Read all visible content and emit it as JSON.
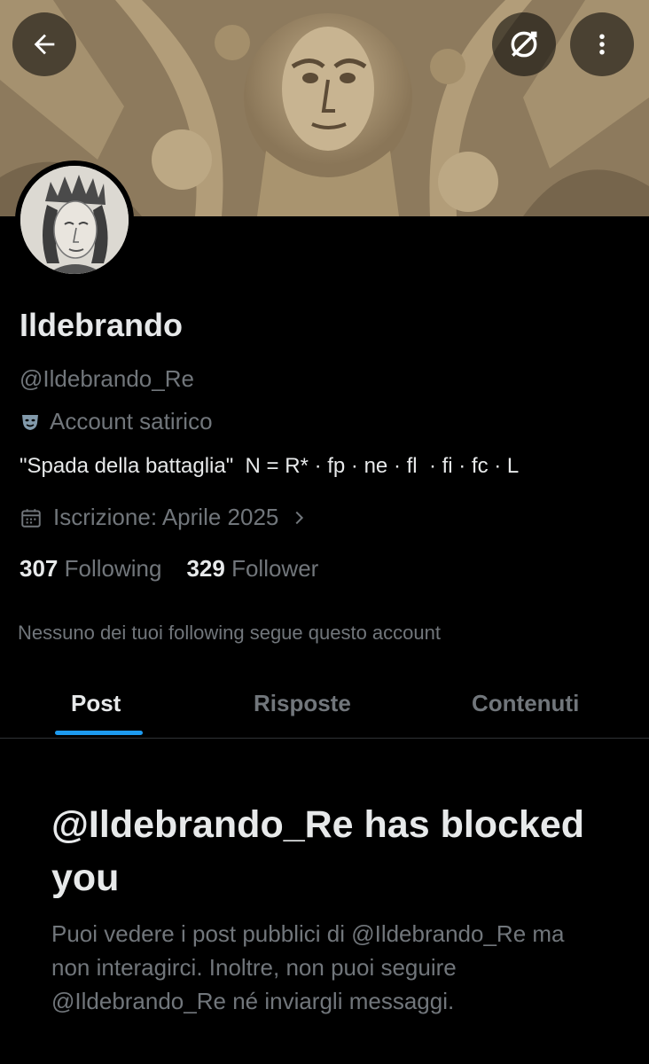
{
  "header": {
    "back_icon": "arrow-left-icon",
    "translate_icon": "globe-slash-icon",
    "more_icon": "more-vertical-icon"
  },
  "profile": {
    "name": "Ildebrando",
    "handle": "@Ildebrando_Re",
    "label_icon": "theater-mask-icon",
    "label": "Account satirico",
    "bio": "\"Spada della battaglia\"  N = R* · fp · ne · fl  · fi · fc · L",
    "joined": "Iscrizione: Aprile 2025",
    "following_count": "307",
    "following_label": "Following",
    "followers_count": "329",
    "followers_label": "Follower",
    "mutual_note": "Nessuno dei tuoi following segue questo account"
  },
  "tabs": [
    {
      "label": "Post",
      "active": true
    },
    {
      "label": "Risposte",
      "active": false
    },
    {
      "label": "Contenuti",
      "active": false
    }
  ],
  "blocked": {
    "title": "@Ildebrando_Re has blocked you",
    "message": "Puoi vedere i post pubblici di @Ildebrando_Re ma non interagirci. Inoltre, non puoi seguire @Ildebrando_Re né inviargli messaggi."
  },
  "colors": {
    "accent": "#1d9bf0",
    "text_primary": "#e7e9ea",
    "text_secondary": "#71767b",
    "background": "#000000"
  }
}
